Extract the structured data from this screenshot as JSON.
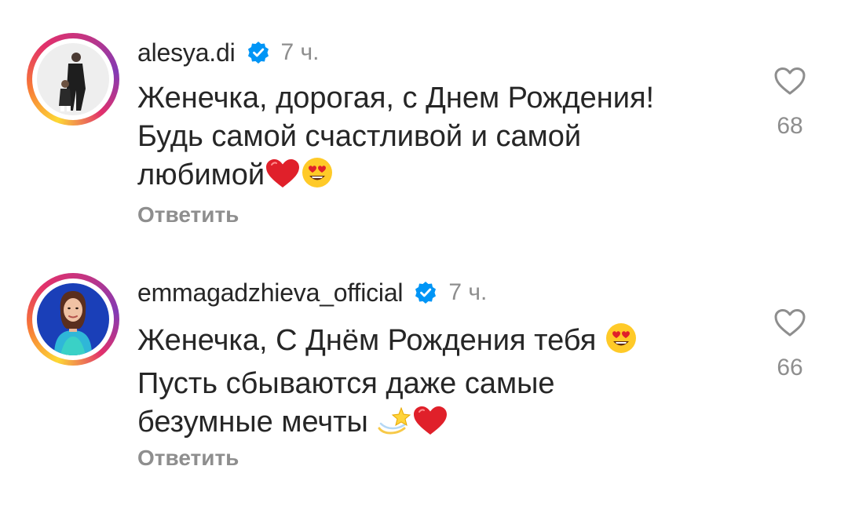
{
  "comments": [
    {
      "username": "alesya.di",
      "time": "7 ч.",
      "lines": [
        "Женечка, дорогая, с Днем Рождения!",
        "Будь самой счастливой и самой",
        "любимой"
      ],
      "emojis": [
        "red-heart",
        "heart-eyes"
      ],
      "reply_label": "Ответить",
      "likes": "68"
    },
    {
      "username": "emmagadzhieva_official",
      "time": "7 ч.",
      "lines": [
        "Женечка, С Днём Рождения тебя",
        "Пусть сбываются даже самые",
        "безумные мечты"
      ],
      "emojis": [
        "heart-eyes",
        "dizzy",
        "red-heart"
      ],
      "reply_label": "Ответить",
      "likes": "66"
    }
  ],
  "colors": {
    "text": "#262626",
    "muted": "#8e8e8e",
    "verified": "#0095f6"
  }
}
